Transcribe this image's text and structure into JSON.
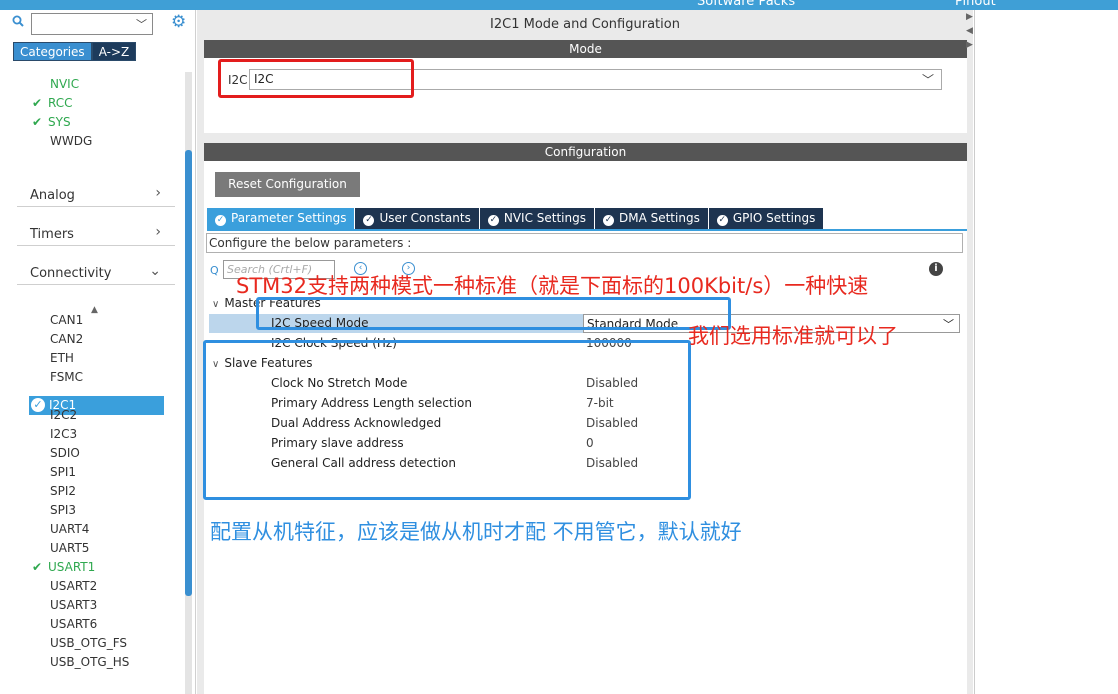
{
  "topbar": {
    "software_packs": "Software Packs",
    "pinout": "Pinout"
  },
  "left": {
    "tabs": [
      "Categories",
      "A->Z"
    ],
    "items_top": [
      {
        "label": "NVIC",
        "checked": false,
        "green": true
      },
      {
        "label": "RCC",
        "checked": true,
        "green": true
      },
      {
        "label": "SYS",
        "checked": true,
        "green": true
      },
      {
        "label": "WWDG",
        "checked": false,
        "green": false
      }
    ],
    "sections": {
      "analog": "Analog",
      "timers": "Timers",
      "connectivity": "Connectivity"
    },
    "connectivity_items": [
      {
        "label": "CAN1"
      },
      {
        "label": "CAN2"
      },
      {
        "label": "ETH"
      },
      {
        "label": "FSMC"
      },
      {
        "label": "I2C1"
      },
      {
        "label": "I2C2"
      },
      {
        "label": "I2C3"
      },
      {
        "label": "SDIO"
      },
      {
        "label": "SPI1"
      },
      {
        "label": "SPI2"
      },
      {
        "label": "SPI3"
      },
      {
        "label": "UART4"
      },
      {
        "label": "UART5"
      },
      {
        "label": "USART1"
      },
      {
        "label": "USART2"
      },
      {
        "label": "USART3"
      },
      {
        "label": "USART6"
      },
      {
        "label": "USB_OTG_FS"
      },
      {
        "label": "USB_OTG_HS"
      }
    ],
    "selected_item": "I2C1"
  },
  "center": {
    "title": "I2C1 Mode and Configuration",
    "mode_header": "Mode",
    "mode_label": "I2C",
    "mode_value": "I2C",
    "config_header": "Configuration",
    "reset_button": "Reset Configuration",
    "tabs": [
      "Parameter Settings",
      "User Constants",
      "NVIC Settings",
      "DMA Settings",
      "GPIO Settings"
    ],
    "configure_text": "Configure the below parameters :",
    "search_placeholder": "Search (Crtl+F)",
    "master_group": "Master Features",
    "master_rows": [
      {
        "key": "I2C Speed Mode",
        "value": "Standard Mode"
      },
      {
        "key": "I2C Clock Speed (Hz)",
        "value": "100000"
      }
    ],
    "slave_group": "Slave Features",
    "slave_rows": [
      {
        "key": "Clock No Stretch Mode",
        "value": "Disabled"
      },
      {
        "key": "Primary Address Length selection",
        "value": "7-bit"
      },
      {
        "key": "Dual Address Acknowledged",
        "value": "Disabled"
      },
      {
        "key": "Primary slave address",
        "value": "0"
      },
      {
        "key": "General Call address detection",
        "value": "Disabled"
      }
    ]
  },
  "annotations": {
    "red1": "STM32支持两种模式一种标准（就是下面标的100Kbit/s）一种快速",
    "red2": "我们选用标准就可以了",
    "blue": "配置从机特征，应该是做从机时才配 不用管它，默认就好"
  },
  "colors": {
    "accent": "#3a9fdc",
    "check_green": "#2fa84f",
    "annot_red": "#e8291f",
    "annot_blue": "#2f8fe0"
  }
}
